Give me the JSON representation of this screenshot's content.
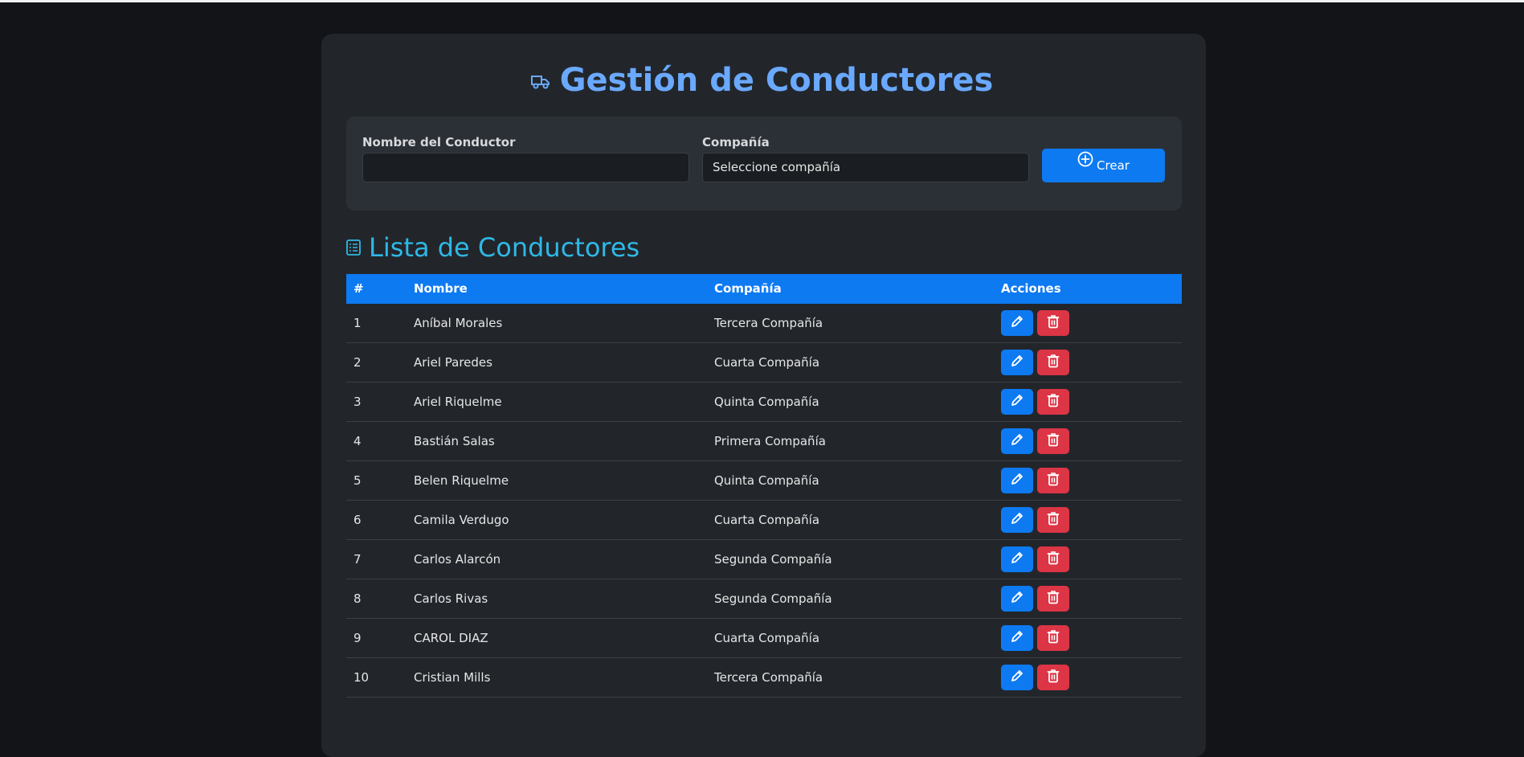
{
  "page": {
    "title": "Gestión de Conductores"
  },
  "form": {
    "driver_label": "Nombre del Conductor",
    "driver_value": "",
    "company_label": "Compañía",
    "company_selected": "Seleccione compañía",
    "create_label": "Crear"
  },
  "list": {
    "title": "Lista de Conductores",
    "columns": [
      "#",
      "Nombre",
      "Compañía",
      "Acciones"
    ],
    "rows": [
      {
        "num": "1",
        "name": "Aníbal Morales",
        "company": "Tercera Compañía"
      },
      {
        "num": "2",
        "name": "Ariel Paredes",
        "company": "Cuarta Compañía"
      },
      {
        "num": "3",
        "name": "Ariel Riquelme",
        "company": "Quinta Compañía"
      },
      {
        "num": "4",
        "name": "Bastián Salas",
        "company": "Primera Compañía"
      },
      {
        "num": "5",
        "name": "Belen Riquelme",
        "company": "Quinta Compañía"
      },
      {
        "num": "6",
        "name": "Camila Verdugo",
        "company": "Cuarta Compañía"
      },
      {
        "num": "7",
        "name": "Carlos Alarcón",
        "company": "Segunda Compañía"
      },
      {
        "num": "8",
        "name": "Carlos Rivas",
        "company": "Segunda Compañía"
      },
      {
        "num": "9",
        "name": "CAROL DIAZ",
        "company": "Cuarta Compañía"
      },
      {
        "num": "10",
        "name": "Cristian Mills",
        "company": "Tercera Compañía"
      }
    ]
  },
  "colors": {
    "accent_blue": "#0d7af2",
    "title_blue": "#6aa9ff",
    "list_title": "#2fb8e6",
    "danger": "#dc3545"
  },
  "icons": {
    "title": "truck-icon",
    "create": "plus-circle-icon",
    "list": "list-icon",
    "edit": "pencil-icon",
    "delete": "trash-icon"
  }
}
